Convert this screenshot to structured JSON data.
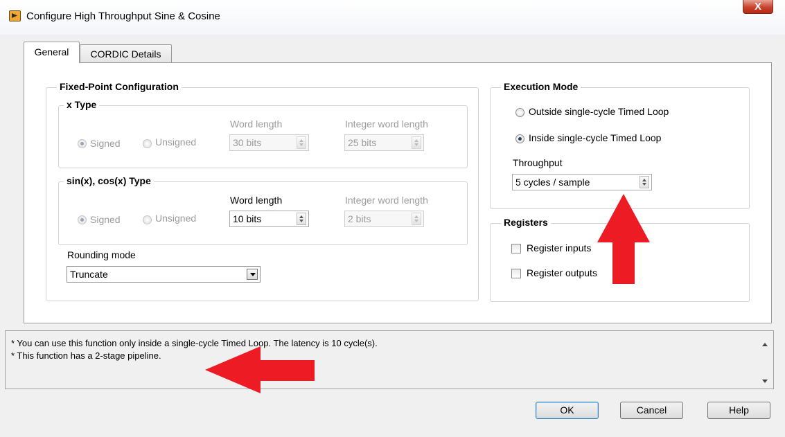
{
  "window": {
    "title": "Configure High Throughput Sine & Cosine",
    "close_glyph": "X"
  },
  "tabs": [
    {
      "label": "General",
      "active": true
    },
    {
      "label": "CORDIC Details",
      "active": false
    }
  ],
  "fixed_point": {
    "title": "Fixed-Point Configuration",
    "x_type": {
      "title": "x Type",
      "signed_label": "Signed",
      "unsigned_label": "Unsigned",
      "selected": "Signed",
      "word_length_label": "Word length",
      "word_length_value": "30 bits",
      "integer_word_length_label": "Integer word length",
      "integer_word_length_value": "25 bits"
    },
    "sincos_type": {
      "title": "sin(x), cos(x) Type",
      "signed_label": "Signed",
      "unsigned_label": "Unsigned",
      "selected": "Signed",
      "word_length_label": "Word length",
      "word_length_value": "10 bits",
      "integer_word_length_label": "Integer word length",
      "integer_word_length_value": "2 bits"
    },
    "rounding_mode_label": "Rounding mode",
    "rounding_mode_value": "Truncate"
  },
  "execution_mode": {
    "title": "Execution Mode",
    "option_outside": "Outside single-cycle Timed Loop",
    "option_inside": "Inside single-cycle Timed Loop",
    "selected": "Inside single-cycle Timed Loop",
    "throughput_label": "Throughput",
    "throughput_value": "5 cycles / sample"
  },
  "registers": {
    "title": "Registers",
    "register_inputs": "Register inputs",
    "register_outputs": "Register outputs",
    "register_inputs_checked": false,
    "register_outputs_checked": false
  },
  "messages": {
    "line1": "* You can use this function only inside a single-cycle Timed Loop. The latency is 10 cycle(s).",
    "line2": "* This function has a 2-stage pipeline."
  },
  "buttons": {
    "ok": "OK",
    "cancel": "Cancel",
    "help": "Help"
  },
  "colors": {
    "annotation_arrow": "#ed1c24",
    "close_button": "#c8432d",
    "selected_radio": "#2a3f66"
  },
  "icons": {
    "app": "labview-vi-icon",
    "close": "close-icon",
    "annotation": "red-arrow-icon"
  }
}
